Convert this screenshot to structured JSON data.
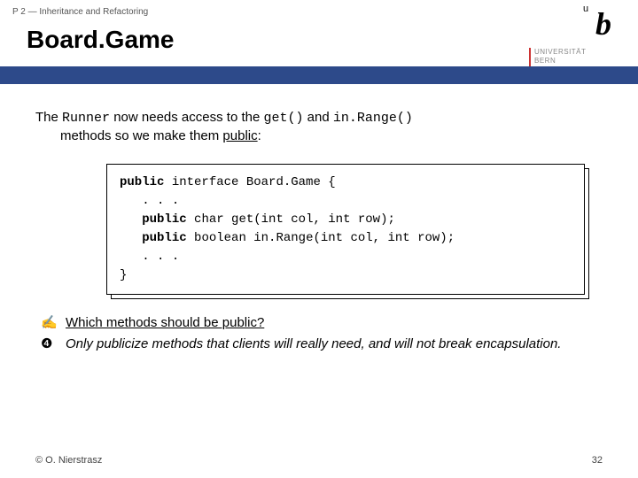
{
  "header": {
    "breadcrumb": "P 2 — Inheritance and Refactoring",
    "title": "Board.Game"
  },
  "logo": {
    "u": "u",
    "b": "b",
    "uni1": "UNIVERSITÄT",
    "uni2": "BERN"
  },
  "intro": {
    "t1": "The ",
    "t2": "Runner",
    "t3": " now needs access to the ",
    "t4": "get()",
    "t5": " and ",
    "t6": "in.Range()",
    "t7": "methods so we make them ",
    "t8": "public",
    "t9": ":"
  },
  "code": {
    "l1a": "public",
    "l1b": " interface Board.Game {",
    "l2": ". . .",
    "l3a": "public",
    "l3b": " char get(int col, int row);",
    "l4a": "public",
    "l4b": " boolean in.Range(int col, int row);",
    "l5": ". . .",
    "l6": "}"
  },
  "qna": {
    "q_icon": "✍",
    "q_text": "Which methods should be public?",
    "a_icon": "❹",
    "a_text": "Only publicize methods that clients will really need, and will not break encapsulation."
  },
  "footer": {
    "copyright": "© O. Nierstrasz",
    "page": "32"
  }
}
